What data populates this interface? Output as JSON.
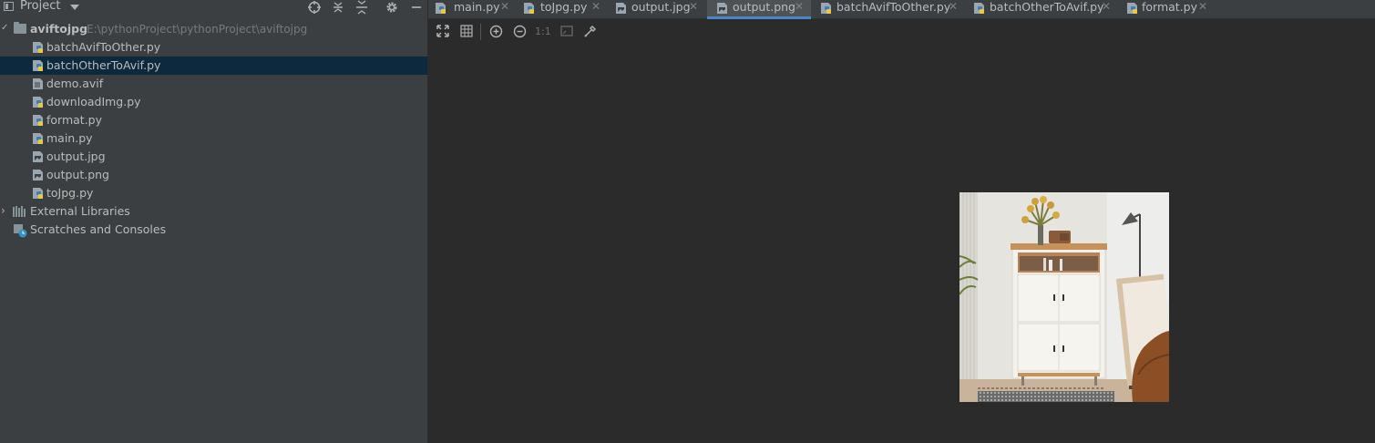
{
  "project_panel": {
    "title": "Project",
    "root": {
      "name": "aviftojpg",
      "path": "E:\\pythonProject\\pythonProject\\aviftojpg"
    },
    "files": [
      {
        "label": "batchAvifToOther.py",
        "kind": "python"
      },
      {
        "label": "batchOtherToAvif.py",
        "kind": "python",
        "selected": true
      },
      {
        "label": "demo.avif",
        "kind": "generic"
      },
      {
        "label": "downloadImg.py",
        "kind": "python"
      },
      {
        "label": "format.py",
        "kind": "python"
      },
      {
        "label": "main.py",
        "kind": "python"
      },
      {
        "label": "output.jpg",
        "kind": "image"
      },
      {
        "label": "output.png",
        "kind": "image"
      },
      {
        "label": "toJpg.py",
        "kind": "python"
      }
    ],
    "external_libraries": "External Libraries",
    "scratches": "Scratches and Consoles"
  },
  "tabs": [
    {
      "label": "main.py",
      "kind": "python"
    },
    {
      "label": "toJpg.py",
      "kind": "python"
    },
    {
      "label": "output.jpg",
      "kind": "image"
    },
    {
      "label": "output.png",
      "kind": "image",
      "active": true
    },
    {
      "label": "batchAvifToOther.py",
      "kind": "python"
    },
    {
      "label": "batchOtherToAvif.py",
      "kind": "python"
    },
    {
      "label": "format.py",
      "kind": "python"
    }
  ],
  "image_toolbar": {
    "actual_size_label": "1:1"
  },
  "colors": {
    "selection": "#0d293e",
    "active_tab_underline": "#4a88c7",
    "editor_bg": "#2b2b2b",
    "panel_bg": "#3c3f41"
  }
}
